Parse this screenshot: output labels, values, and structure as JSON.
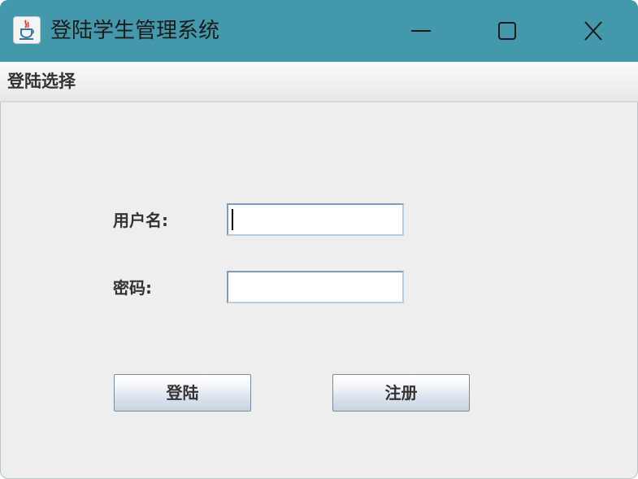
{
  "window": {
    "title": "登陆学生管理系统",
    "icon": "java-cup-icon",
    "controls": [
      "minimize-icon",
      "maximize-icon",
      "close-icon"
    ]
  },
  "menubar": {
    "items": [
      {
        "label": "登陆选择"
      }
    ]
  },
  "form": {
    "username_label": "用户名:",
    "username_value": "",
    "password_label": "密码:",
    "password_value": "",
    "login_label": "登陆",
    "register_label": "注册"
  },
  "colors": {
    "titlebar": "#4498ab",
    "content_bg": "#eeeeee",
    "field_border": "#7f9db9"
  }
}
